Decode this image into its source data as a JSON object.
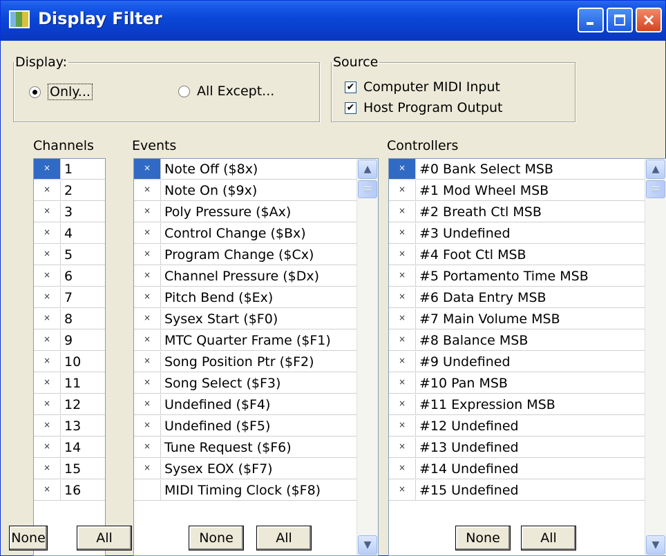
{
  "window": {
    "title": "Display Filter"
  },
  "display_group": {
    "legend": "Display:",
    "only_label": "Only...",
    "all_except_label": "All Except...",
    "selected": "Only..."
  },
  "source_group": {
    "legend": "Source",
    "computer_midi_input_label": "Computer MIDI Input",
    "computer_midi_input_checked": true,
    "host_program_output_label": "Host Program Output",
    "host_program_output_checked": true
  },
  "channels": {
    "header": "Channels",
    "items": [
      {
        "mark": "×",
        "label": "1",
        "selected": true
      },
      {
        "mark": "×",
        "label": "2"
      },
      {
        "mark": "×",
        "label": "3"
      },
      {
        "mark": "×",
        "label": "4"
      },
      {
        "mark": "×",
        "label": "5"
      },
      {
        "mark": "×",
        "label": "6"
      },
      {
        "mark": "×",
        "label": "7"
      },
      {
        "mark": "×",
        "label": "8"
      },
      {
        "mark": "×",
        "label": "9"
      },
      {
        "mark": "×",
        "label": "10"
      },
      {
        "mark": "×",
        "label": "11"
      },
      {
        "mark": "×",
        "label": "12"
      },
      {
        "mark": "×",
        "label": "13"
      },
      {
        "mark": "×",
        "label": "14"
      },
      {
        "mark": "×",
        "label": "15"
      },
      {
        "mark": "×",
        "label": "16"
      }
    ],
    "none_label": "None",
    "all_label": "All"
  },
  "events": {
    "header": "Events",
    "items": [
      {
        "mark": "×",
        "label": "Note Off ($8x)",
        "selected": true
      },
      {
        "mark": "×",
        "label": "Note On ($9x)"
      },
      {
        "mark": "×",
        "label": "Poly Pressure ($Ax)"
      },
      {
        "mark": "×",
        "label": "Control Change ($Bx)"
      },
      {
        "mark": "×",
        "label": "Program Change ($Cx)"
      },
      {
        "mark": "×",
        "label": "Channel Pressure ($Dx)"
      },
      {
        "mark": "×",
        "label": "Pitch Bend ($Ex)"
      },
      {
        "mark": "×",
        "label": "Sysex Start ($F0)"
      },
      {
        "mark": "×",
        "label": "MTC Quarter Frame ($F1)"
      },
      {
        "mark": "×",
        "label": "Song Position Ptr ($F2)"
      },
      {
        "mark": "×",
        "label": "Song Select ($F3)"
      },
      {
        "mark": "×",
        "label": "Undefined ($F4)"
      },
      {
        "mark": "×",
        "label": "Undefined ($F5)"
      },
      {
        "mark": "×",
        "label": "Tune Request ($F6)"
      },
      {
        "mark": "×",
        "label": "Sysex EOX ($F7)"
      },
      {
        "mark": "",
        "label": "MIDI Timing Clock ($F8)"
      }
    ],
    "none_label": "None",
    "all_label": "All"
  },
  "controllers": {
    "header": "Controllers",
    "items": [
      {
        "mark": "×",
        "label": "#0 Bank Select MSB",
        "selected": true
      },
      {
        "mark": "×",
        "label": "#1 Mod Wheel MSB"
      },
      {
        "mark": "×",
        "label": "#2 Breath Ctl MSB"
      },
      {
        "mark": "×",
        "label": "#3 Undefined"
      },
      {
        "mark": "×",
        "label": "#4 Foot Ctl MSB"
      },
      {
        "mark": "×",
        "label": "#5 Portamento Time MSB"
      },
      {
        "mark": "×",
        "label": "#6 Data Entry MSB"
      },
      {
        "mark": "×",
        "label": "#7 Main Volume MSB"
      },
      {
        "mark": "×",
        "label": "#8 Balance MSB"
      },
      {
        "mark": "×",
        "label": "#9 Undefined"
      },
      {
        "mark": "×",
        "label": "#10 Pan MSB"
      },
      {
        "mark": "×",
        "label": "#11 Expression MSB"
      },
      {
        "mark": "×",
        "label": "#12 Undefined"
      },
      {
        "mark": "×",
        "label": "#13 Undefined"
      },
      {
        "mark": "×",
        "label": "#14 Undefined"
      },
      {
        "mark": "×",
        "label": "#15 Undefined"
      }
    ],
    "none_label": "None",
    "all_label": "All"
  },
  "icons": {
    "app": "app-icon",
    "minimize": "minimize-icon",
    "maximize": "maximize-icon",
    "close": "close-icon",
    "scroll_up": "chevron-up-icon",
    "scroll_down": "chevron-down-icon"
  },
  "colors": {
    "titlebar": "#0a46d6",
    "selection": "#316ac5",
    "dialog_bg": "#ece9d8",
    "close_button": "#d8431f"
  }
}
